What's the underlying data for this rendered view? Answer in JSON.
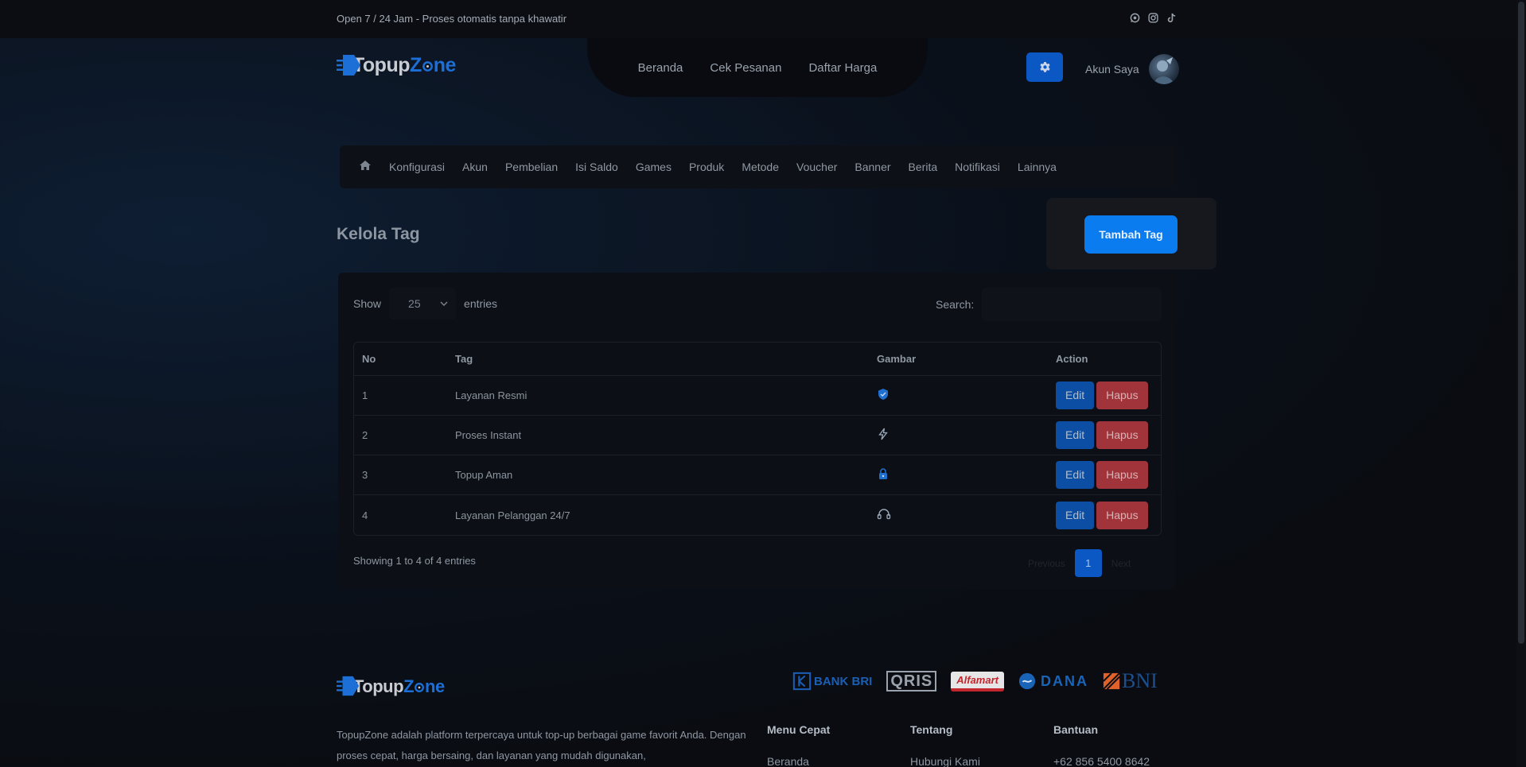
{
  "topbar": {
    "tagline": "Open 7 / 24 Jam - Proses otomatis tanpa khawatir",
    "socials": [
      "whatsapp-icon",
      "instagram-icon",
      "tiktok-icon"
    ]
  },
  "brand": {
    "part1": "Topup",
    "part2": "Z",
    "part3": "ne"
  },
  "nav": {
    "items": [
      "Beranda",
      "Cek Pesanan",
      "Daftar Harga"
    ]
  },
  "account": {
    "label": "Akun Saya"
  },
  "admin_menu": {
    "items": [
      "Konfigurasi",
      "Akun",
      "Pembelian",
      "Isi Saldo",
      "Games",
      "Produk",
      "Metode",
      "Voucher",
      "Banner",
      "Berita",
      "Notifikasi",
      "Lainnya"
    ]
  },
  "page": {
    "title": "Kelola Tag",
    "add_button": "Tambah Tag"
  },
  "table_controls": {
    "show_label": "Show",
    "entries_value": "25",
    "entries_label": "entries",
    "search_label": "Search:",
    "search_value": ""
  },
  "table": {
    "headers": [
      "No",
      "Tag",
      "Gambar",
      "Action"
    ],
    "rows": [
      {
        "no": "1",
        "tag": "Layanan Resmi",
        "icon": "shield-check-icon"
      },
      {
        "no": "2",
        "tag": "Proses Instant",
        "icon": "lightning-icon"
      },
      {
        "no": "3",
        "tag": "Topup Aman",
        "icon": "lock-icon"
      },
      {
        "no": "4",
        "tag": "Layanan Pelanggan 24/7",
        "icon": "headset-icon"
      }
    ],
    "edit_label": "Edit",
    "delete_label": "Hapus"
  },
  "pagination": {
    "info": "Showing 1 to 4 of 4 entries",
    "previous": "Previous",
    "current": "1",
    "next": "Next"
  },
  "footer": {
    "payments": [
      "BANK BRI",
      "QRIS",
      "Alfamart",
      "DANA",
      "BNI"
    ],
    "about": "TopupZone adalah platform terpercaya untuk top-up berbagai game favorit Anda. Dengan proses cepat, harga bersaing, dan layanan yang mudah digunakan,",
    "columns": [
      {
        "title": "Menu Cepat",
        "first_link": "Beranda"
      },
      {
        "title": "Tentang",
        "first_link": "Hubungi Kami"
      },
      {
        "title": "Bantuan",
        "first_link": "+62 856 5400 8642"
      }
    ]
  },
  "colors": {
    "accent": "#0a7cf0",
    "edit": "#0b4ea3",
    "delete": "#a1333a",
    "background": "#0a0c11"
  }
}
